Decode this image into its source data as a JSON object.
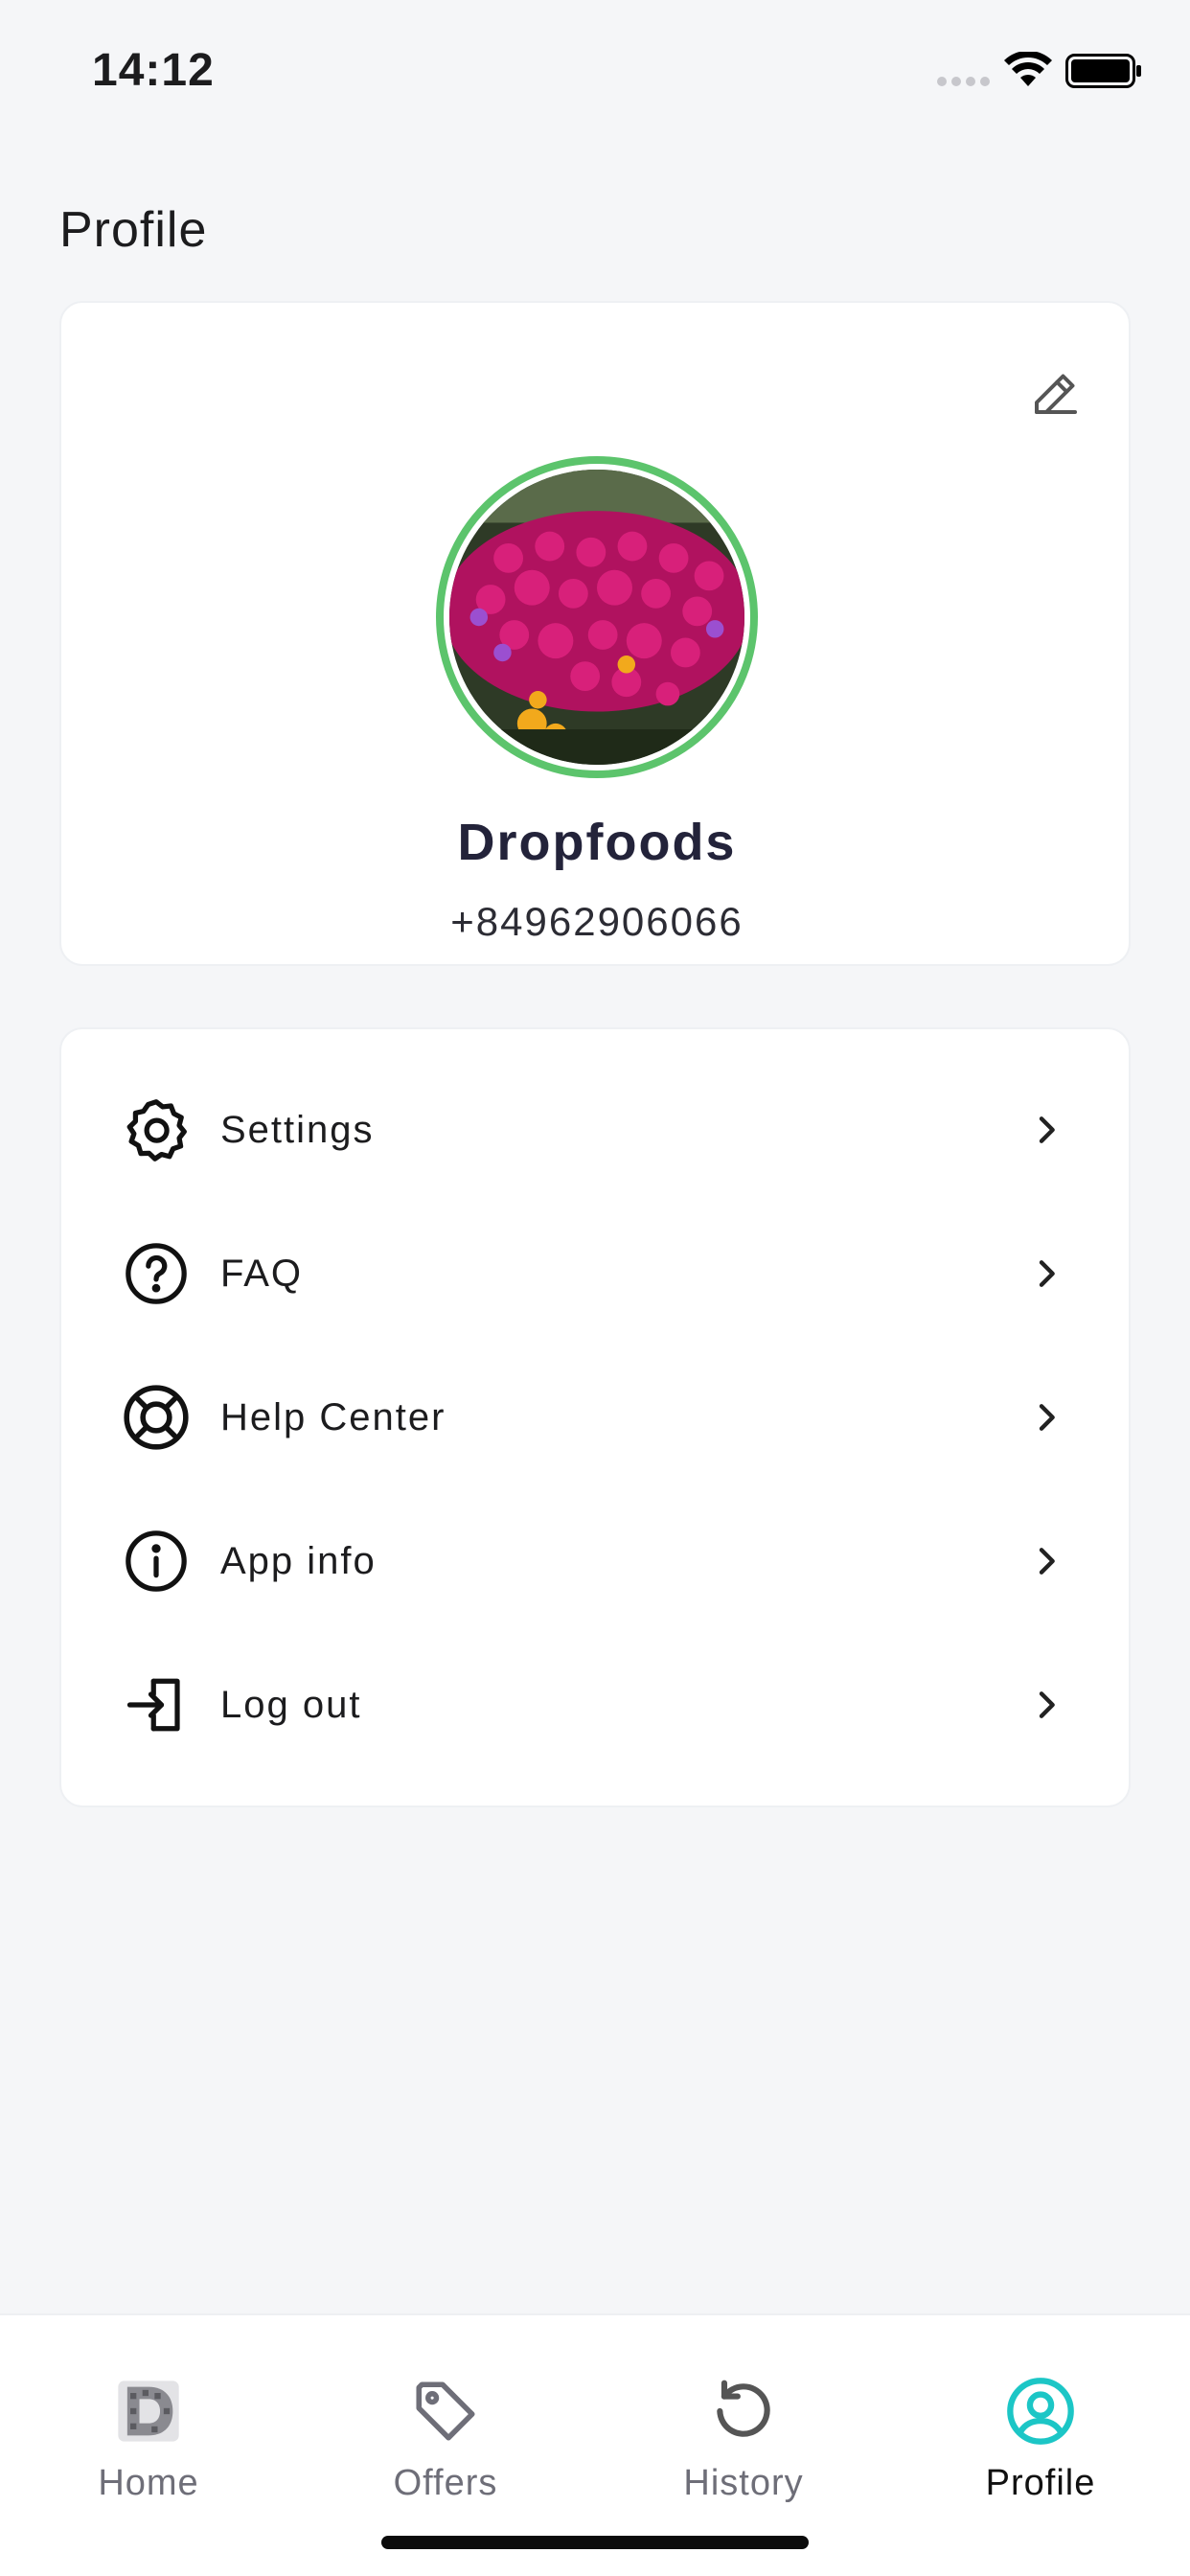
{
  "status_bar": {
    "time": "14:12"
  },
  "page": {
    "title": "Profile"
  },
  "profile": {
    "name": "Dropfoods",
    "phone": "+84962906066"
  },
  "menu": {
    "items": [
      {
        "label": "Settings",
        "icon": "gear-icon"
      },
      {
        "label": "FAQ",
        "icon": "question-circle-icon"
      },
      {
        "label": "Help Center",
        "icon": "lifebuoy-icon"
      },
      {
        "label": "App info",
        "icon": "info-circle-icon"
      },
      {
        "label": "Log out",
        "icon": "logout-icon"
      }
    ]
  },
  "tabs": [
    {
      "label": "Home",
      "icon": "home-logo-icon",
      "active": false
    },
    {
      "label": "Offers",
      "icon": "tag-icon",
      "active": false
    },
    {
      "label": "History",
      "icon": "history-icon",
      "active": false
    },
    {
      "label": "Profile",
      "icon": "user-circle-icon",
      "active": true
    }
  ],
  "colors": {
    "background": "#f5f6f8",
    "avatar_ring": "#5cc46c",
    "active_tab": "#1cc6c6",
    "text": "#1c1c1e"
  }
}
